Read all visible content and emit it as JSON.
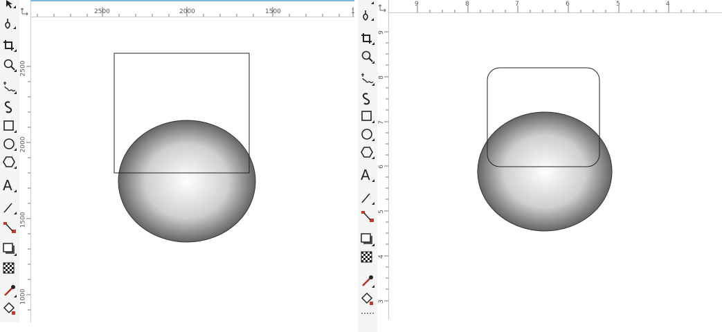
{
  "left_panel": {
    "hruler_labels": [
      "2500",
      "2000",
      "1500",
      "1"
    ],
    "vruler_labels": [
      "2500",
      "2000",
      "1500",
      "1000"
    ],
    "tools": [
      {
        "name": "pick-tool-icon"
      },
      {
        "name": "shape-tool-icon"
      },
      {
        "name": "crop-tool-icon"
      },
      {
        "name": "zoom-tool-icon"
      },
      {
        "name": "freehand-tool-icon"
      },
      {
        "name": "artistic-media-tool-icon"
      },
      {
        "name": "rectangle-tool-icon"
      },
      {
        "name": "ellipse-tool-icon"
      },
      {
        "name": "polygon-tool-icon"
      },
      {
        "name": "text-tool-icon"
      },
      {
        "name": "parallel-dimension-tool-icon"
      },
      {
        "name": "connector-tool-icon"
      },
      {
        "name": "drop-shadow-tool-icon"
      },
      {
        "name": "transparency-tool-icon"
      },
      {
        "name": "eyedropper-tool-icon"
      },
      {
        "name": "fill-tool-icon"
      }
    ]
  },
  "right_panel": {
    "hruler_labels": [
      "9",
      "8",
      "7",
      "6",
      "5",
      "4"
    ],
    "vruler_labels": [
      "9",
      "8",
      "7",
      "6",
      "5",
      "4",
      "3"
    ]
  },
  "text_tool_glyph": "A",
  "colors": {
    "ruler_bg": "#ffffff",
    "toolbox_bg": "#f5f5f5",
    "connector_red": "#c0392b",
    "eyedropper_red": "#b03020",
    "ruler_highlight": "#7ab6e0"
  }
}
